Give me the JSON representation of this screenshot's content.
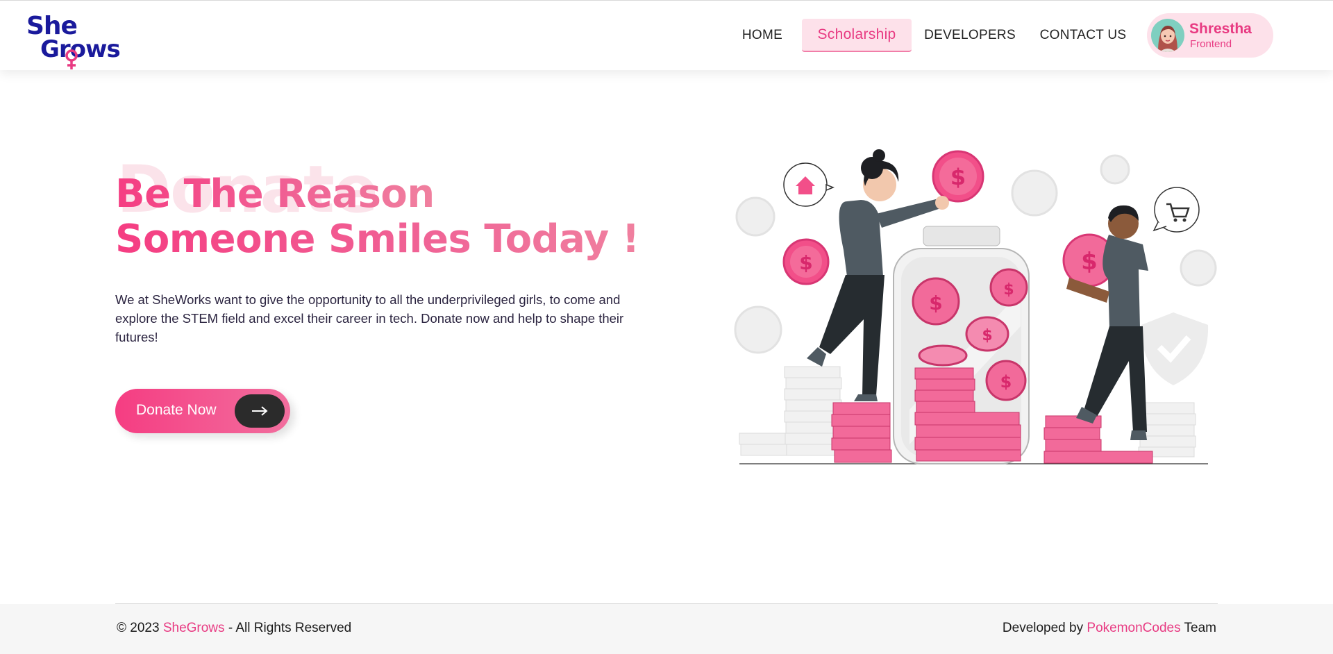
{
  "logo": {
    "line1": "She",
    "line2": "Grows"
  },
  "nav": {
    "home": "HOME",
    "scholarship": "Scholarship",
    "developers": "DEVELOPERS",
    "contact": "CONTACT US"
  },
  "profile": {
    "name": "Shrestha",
    "role": "Frontend"
  },
  "hero": {
    "background_word": "Donate",
    "title_line1": "Be The Reason",
    "title_line2": "Someone Smiles Today !",
    "description": "We at SheWorks want to give the opportunity to all the underprivileged girls, to come and explore the STEM field and excel their career in tech. Donate now and help to shape their futures!",
    "cta_label": "Donate Now"
  },
  "footer": {
    "copyright": "© 2023",
    "brand": "SheGrows",
    "rights": "- All Rights Reserved",
    "developed_by": "Developed by",
    "team_name": "PokemonCodes",
    "team_suffix": "Team"
  },
  "colors": {
    "primary_pink": "#e83a82",
    "pink_light": "#fde1ea",
    "logo_navy": "#1a1a9c",
    "dark": "#2b2b2b"
  },
  "icons": [
    "venus-icon",
    "arrow-right-icon",
    "home-icon",
    "cart-icon",
    "dollar-coin-icon",
    "shield-check-icon"
  ]
}
